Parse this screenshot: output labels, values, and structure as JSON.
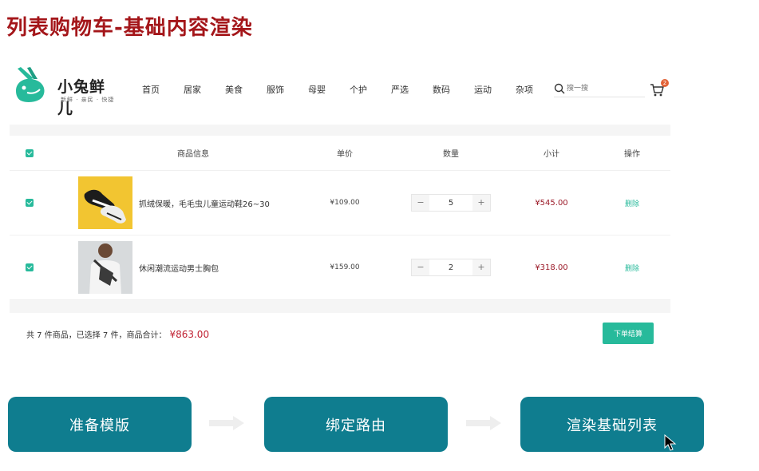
{
  "slide": {
    "title": "列表购物车-基础内容渲染"
  },
  "header": {
    "logo_text": "小兔鲜儿",
    "logo_tagline": "新鲜 · 亲民 · 快捷",
    "nav": [
      "首页",
      "居家",
      "美食",
      "服饰",
      "母婴",
      "个护",
      "严选",
      "数码",
      "运动",
      "杂项"
    ],
    "search_placeholder": "搜一搜",
    "cart_count": "2",
    "colors": {
      "brand": "#27ba9b"
    }
  },
  "cart": {
    "columns": [
      "商品信息",
      "单价",
      "数量",
      "小计",
      "操作"
    ],
    "items": [
      {
        "name": "抓绒保暖，毛毛虫儿童运动鞋26~30",
        "price": "¥109.00",
        "count": "5",
        "subtotal": "¥545.00",
        "action": "删除",
        "image_icon": "kids-shoes-icon"
      },
      {
        "name": "休闲潮流运动男士胸包",
        "price": "¥159.00",
        "count": "2",
        "subtotal": "¥318.00",
        "action": "删除",
        "image_icon": "chest-bag-icon"
      }
    ],
    "stepper": {
      "minus": "−",
      "plus": "+"
    },
    "summary": {
      "text": "共 7 件商品，已选择 7 件，商品合计：",
      "total": "¥863.00"
    },
    "checkout_label": "下单结算"
  },
  "steps": [
    "准备模版",
    "绑定路由",
    "渲染基础列表"
  ]
}
